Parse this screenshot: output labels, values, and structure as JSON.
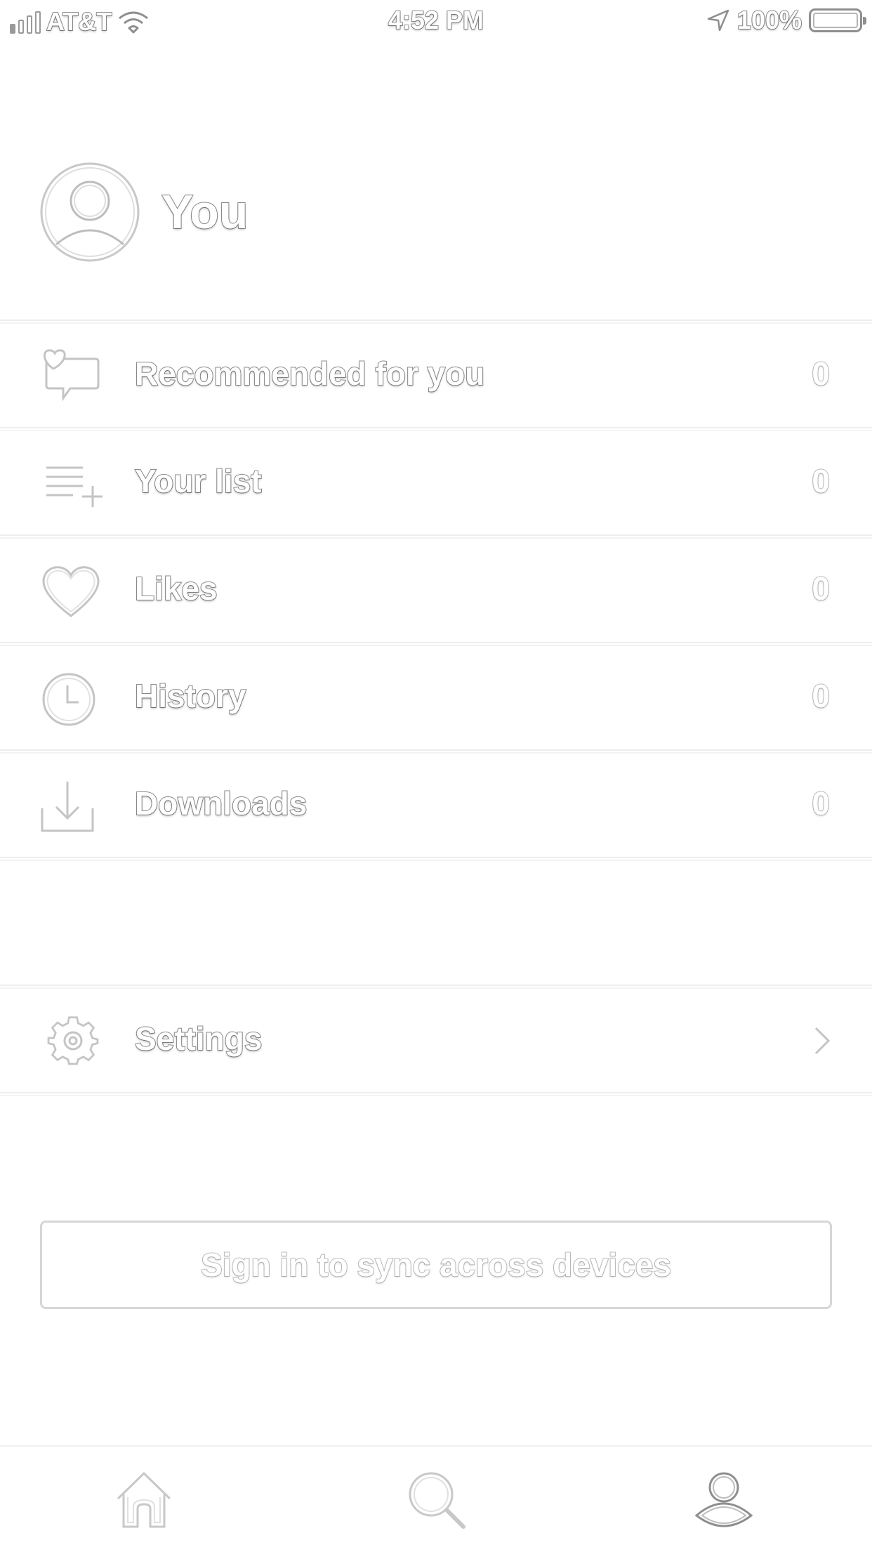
{
  "status_bar": {
    "carrier": "AT&T",
    "time": "4:52 PM",
    "battery_percent": "100%",
    "signal_bars_filled": 1,
    "signal_bars_total": 4
  },
  "profile": {
    "name": "You",
    "avatar_icon": "user-avatar-icon"
  },
  "menu": {
    "items": [
      {
        "label": "Recommended for you",
        "count": "0",
        "icon": "recommended-heart-chat-icon"
      },
      {
        "label": "Your list",
        "count": "0",
        "icon": "playlist-add-icon"
      },
      {
        "label": "Likes",
        "count": "0",
        "icon": "heart-icon"
      },
      {
        "label": "History",
        "count": "0",
        "icon": "clock-icon"
      },
      {
        "label": "Downloads",
        "count": "0",
        "icon": "download-icon"
      }
    ],
    "settings": {
      "label": "Settings",
      "icon": "gear-icon"
    }
  },
  "signin_button": {
    "label": "Sign in to sync across devices"
  },
  "tab_bar": {
    "tabs": [
      {
        "name": "home",
        "icon": "home-icon",
        "active": false
      },
      {
        "name": "search",
        "icon": "search-icon",
        "active": false
      },
      {
        "name": "you",
        "icon": "profile-icon",
        "active": true
      }
    ]
  },
  "colors": {
    "outline": "#8e8e8e",
    "outline_light": "#bdbdbd",
    "divider": "#eeeeee",
    "background": "#ffffff"
  }
}
